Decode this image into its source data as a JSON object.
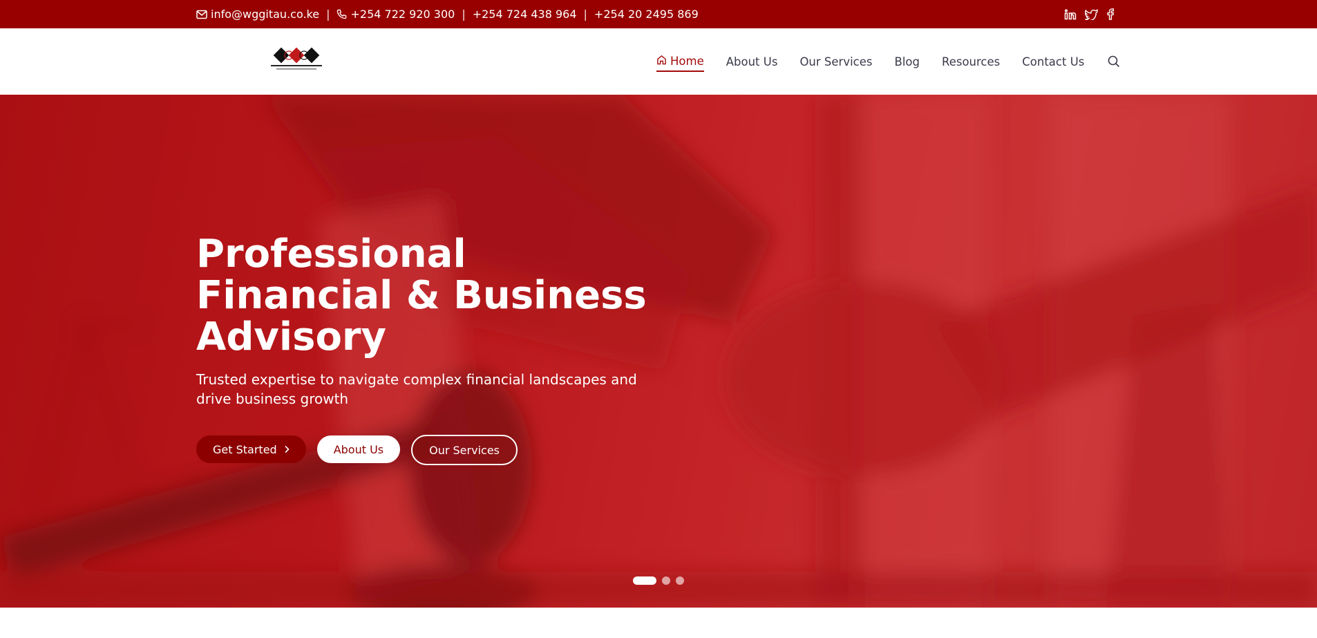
{
  "topbar": {
    "email": "info@wggitau.co.ke",
    "phones": [
      "+254 722 920 300",
      "+254 724 438 964",
      "+254 20 2495 869"
    ],
    "separator": "|",
    "social_icons": [
      "linkedin-icon",
      "twitter-icon",
      "facebook-icon"
    ]
  },
  "logo": {
    "name": "W.G. GITAU & ASSOCIATES",
    "tagline": "Certified Public Accountants (K)"
  },
  "nav": {
    "items": [
      "Home",
      "About Us",
      "Our Services",
      "Blog",
      "Resources",
      "Contact Us"
    ],
    "active": "Home"
  },
  "hero": {
    "title_lines": [
      "Professional",
      "Financial & Business",
      "Advisory"
    ],
    "subtitle": "Trusted expertise to navigate complex financial landscapes and drive business growth",
    "buttons": {
      "primary": "Get Started",
      "secondary": "About Us",
      "tertiary": "Our Services"
    },
    "slides": 3,
    "active_slide": 1
  },
  "colors": {
    "topbar": "#980000",
    "accent": "#a30b0b",
    "button_primary": "#8c0000",
    "hero_overlay": "#c0282b"
  }
}
